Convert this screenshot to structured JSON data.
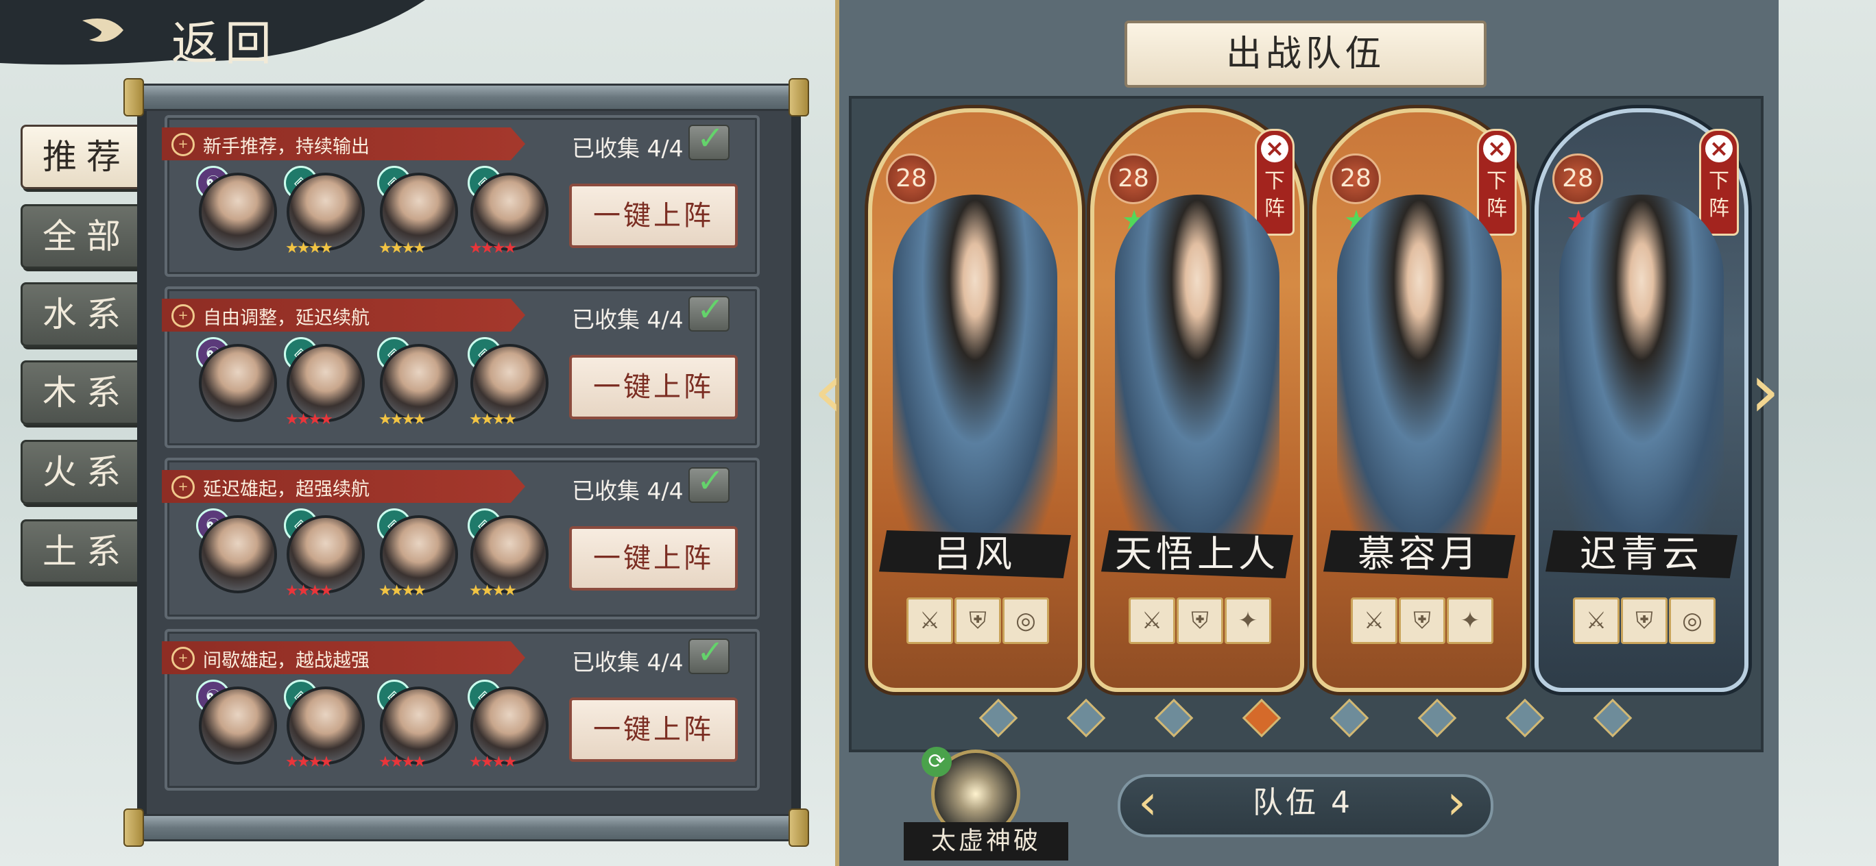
{
  "header": {
    "back_label": "返回"
  },
  "tabs": [
    {
      "label": "推荐",
      "active": true
    },
    {
      "label": "全部",
      "active": false
    },
    {
      "label": "水系",
      "active": false
    },
    {
      "label": "木系",
      "active": false
    },
    {
      "label": "火系",
      "active": false
    },
    {
      "label": "土系",
      "active": false
    }
  ],
  "recommendations": [
    {
      "title": "新手推荐，持续输出",
      "collected": "已收集 4/4",
      "button": "一键上阵"
    },
    {
      "title": "自由调整，延迟续航",
      "collected": "已收集 4/4",
      "button": "一键上阵"
    },
    {
      "title": "延迟雄起，超强续航",
      "collected": "已收集 4/4",
      "button": "一键上阵"
    },
    {
      "title": "间歇雄起，越战越强",
      "collected": "已收集 4/4",
      "button": "一键上阵"
    }
  ],
  "team": {
    "title": "出战队伍",
    "members": [
      {
        "name": "吕风",
        "level": "28",
        "removable": false,
        "style": "orange"
      },
      {
        "name": "天悟上人",
        "level": "28",
        "removable": true,
        "remove_label": "下阵",
        "style": "orange"
      },
      {
        "name": "慕容月",
        "level": "28",
        "removable": true,
        "remove_label": "下阵",
        "style": "orange"
      },
      {
        "name": "迟青云",
        "level": "28",
        "removable": true,
        "remove_label": "下阵",
        "style": "blue"
      }
    ],
    "page_indicator": {
      "total": 8,
      "current": 4
    },
    "skill_name": "太虚神破",
    "team_name": "队伍 4"
  },
  "colors": {
    "accent_red": "#a3241e",
    "gold": "#e8cf8f",
    "panel": "#3c434a"
  }
}
